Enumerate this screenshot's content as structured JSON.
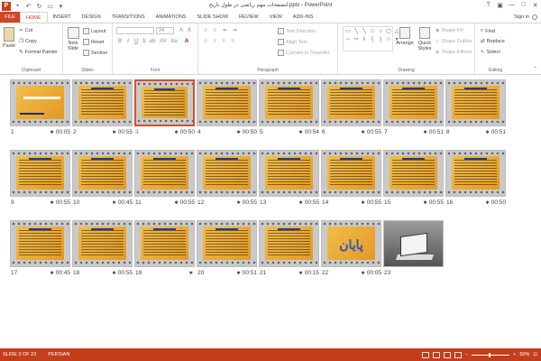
{
  "app": {
    "title": "لتصفحات مهم ریاضی در طول تاریخ.pptx - PowerPoint",
    "logo_letter": "P",
    "sign_in": "Sign in"
  },
  "tabs": [
    {
      "label": "FILE"
    },
    {
      "label": "HOME"
    },
    {
      "label": "INSERT"
    },
    {
      "label": "DESIGN"
    },
    {
      "label": "TRANSITIONS"
    },
    {
      "label": "ANIMATIONS"
    },
    {
      "label": "SLIDE SHOW"
    },
    {
      "label": "REVIEW"
    },
    {
      "label": "VIEW"
    },
    {
      "label": "ADD-INS"
    }
  ],
  "ribbon": {
    "clipboard": {
      "paste": "Paste",
      "cut": "Cut",
      "copy": "Copy",
      "format_painter": "Format Painter",
      "label": "Clipboard"
    },
    "slides": {
      "new_slide": "New",
      "new_slide_2": "Slide",
      "layout": "Layout",
      "reset": "Reset",
      "section": "Section",
      "label": "Slides"
    },
    "font": {
      "size": "24",
      "label": "Font"
    },
    "paragraph": {
      "text_direction": "Text Direction",
      "align_text": "Align Text",
      "smartart": "Convert to SmartArt",
      "label": "Paragraph"
    },
    "drawing": {
      "arrange": "Arrange",
      "quick_styles": "Quick",
      "quick_styles_2": "Styles",
      "shape_fill": "Shape Fill",
      "shape_outline": "Shape Outline",
      "shape_effects": "Shape Effects",
      "label": "Drawing"
    },
    "editing": {
      "find": "Find",
      "replace": "Replace",
      "select": "Select",
      "label": "Editing"
    }
  },
  "slides": [
    {
      "num": "1",
      "time": "00:05"
    },
    {
      "num": "2",
      "time": "00:55"
    },
    {
      "num": "3",
      "time": "00:50"
    },
    {
      "num": "4",
      "time": "00:50"
    },
    {
      "num": "5",
      "time": "00:54"
    },
    {
      "num": "6",
      "time": "00:55"
    },
    {
      "num": "7",
      "time": "00:51"
    },
    {
      "num": "8",
      "time": "00:51"
    },
    {
      "num": "9",
      "time": "00:55"
    },
    {
      "num": "10",
      "time": "00:45"
    },
    {
      "num": "11",
      "time": "00:55"
    },
    {
      "num": "12",
      "time": "00:55"
    },
    {
      "num": "13",
      "time": "00:55"
    },
    {
      "num": "14",
      "time": "00:55"
    },
    {
      "num": "15",
      "time": "00:55"
    },
    {
      "num": "16",
      "time": "00:50"
    },
    {
      "num": "17",
      "time": "00:45"
    },
    {
      "num": "18",
      "time": "00:55"
    },
    {
      "num": "19",
      "time": ""
    },
    {
      "num": "20",
      "time": "00:51"
    },
    {
      "num": "21",
      "time": "00:15"
    },
    {
      "num": "22",
      "time": "00:05"
    },
    {
      "num": "23",
      "time": ""
    }
  ],
  "slide22_text": "پایان",
  "status": {
    "slide_info": "SLIDE 3 OF 23",
    "language": "PERSIAN",
    "zoom": "50%",
    "zoom_level": 0.5,
    "selected_slide": 3
  },
  "colors": {
    "accent": "#c43e1c",
    "selected": "#d2522c"
  }
}
